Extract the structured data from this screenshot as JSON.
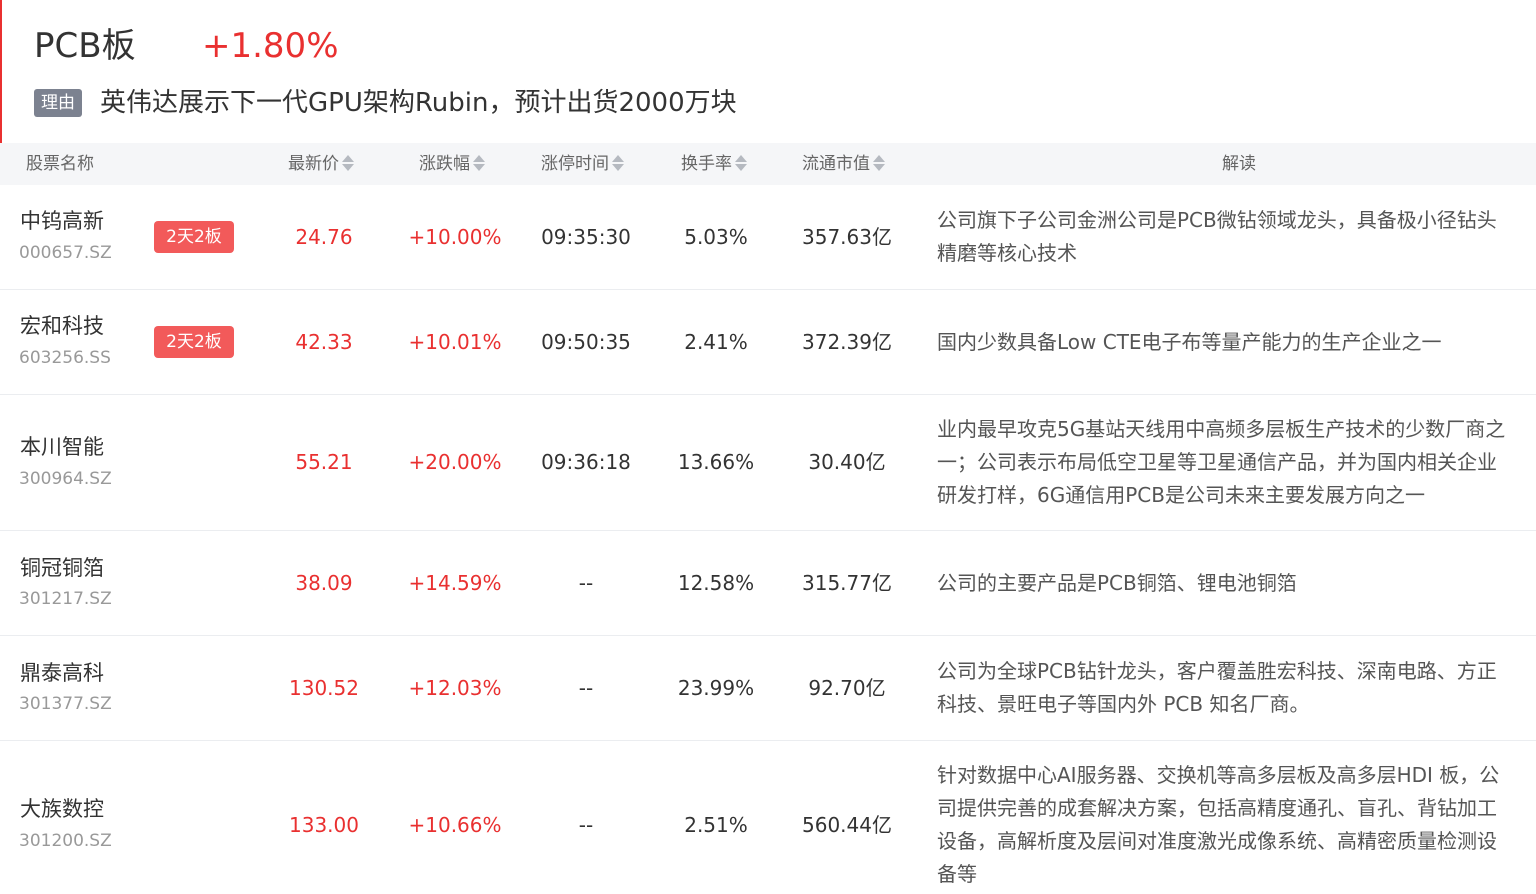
{
  "header": {
    "sector_name": "PCB板",
    "sector_change": "+1.80%",
    "reason_label": "理由",
    "reason_text": "英伟达展示下一代GPU架构Rubin，预计出货2000万块"
  },
  "columns": {
    "name": "股票名称",
    "price": "最新价",
    "change": "涨跌幅",
    "limit_time": "涨停时间",
    "turnover": "换手率",
    "market_cap": "流通市值",
    "explanation": "解读"
  },
  "colors": {
    "up_red": "#e93030",
    "badge_red": "#f25a5a",
    "tag_gray": "#7c8290",
    "header_bg": "#f5f6f8"
  },
  "rows": [
    {
      "name": "中钨高新",
      "code": "000657.SZ",
      "badge": "2天2板",
      "price": "24.76",
      "change": "+10.00%",
      "limit_time": "09:35:30",
      "turnover": "5.03%",
      "market_cap": "357.63亿",
      "desc_lines": [
        "公司旗下子公司金洲公司是PCB微钻领域龙头，具备极小径钻头",
        "精磨等核心技术"
      ]
    },
    {
      "name": "宏和科技",
      "code": "603256.SS",
      "badge": "2天2板",
      "price": "42.33",
      "change": "+10.01%",
      "limit_time": "09:50:35",
      "turnover": "2.41%",
      "market_cap": "372.39亿",
      "desc_lines": [
        "国内少数具备Low CTE电子布等量产能力的生产企业之一"
      ]
    },
    {
      "name": "本川智能",
      "code": "300964.SZ",
      "badge": "",
      "price": "55.21",
      "change": "+20.00%",
      "limit_time": "09:36:18",
      "turnover": "13.66%",
      "market_cap": "30.40亿",
      "desc_lines": [
        "业内最早攻克5G基站天线用中高频多层板生产技术的少数厂商之",
        "一；公司表示布局低空卫星等卫星通信产品，并为国内相关企业",
        "研发打样，6G通信用PCB是公司未来主要发展方向之一"
      ]
    },
    {
      "name": "铜冠铜箔",
      "code": "301217.SZ",
      "badge": "",
      "price": "38.09",
      "change": "+14.59%",
      "limit_time": "--",
      "turnover": "12.58%",
      "market_cap": "315.77亿",
      "desc_lines": [
        "公司的主要产品是PCB铜箔、锂电池铜箔"
      ]
    },
    {
      "name": "鼎泰高科",
      "code": "301377.SZ",
      "badge": "",
      "price": "130.52",
      "change": "+12.03%",
      "limit_time": "--",
      "turnover": "23.99%",
      "market_cap": "92.70亿",
      "desc_lines": [
        "公司为全球PCB钻针龙头，客户覆盖胜宏科技、深南电路、方正",
        "科技、景旺电子等国内外 PCB 知名厂商。"
      ]
    },
    {
      "name": "大族数控",
      "code": "301200.SZ",
      "badge": "",
      "price": "133.00",
      "change": "+10.66%",
      "limit_time": "--",
      "turnover": "2.51%",
      "market_cap": "560.44亿",
      "desc_lines": [
        "针对数据中心AI服务器、交换机等高多层板及高多层HDI 板，公",
        "司提供完善的成套解决方案，包括高精度通孔、盲孔、背钻加工",
        "设备，高解析度及层间对准度激光成像系统、高精密质量检测设",
        "备等"
      ]
    }
  ]
}
